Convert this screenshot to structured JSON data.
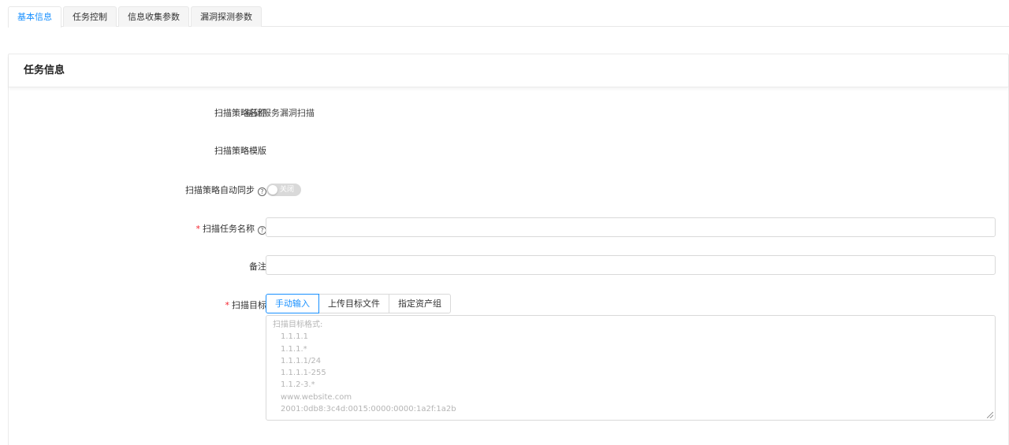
{
  "tabs": [
    {
      "label": "基本信息",
      "active": true
    },
    {
      "label": "任务控制",
      "active": false
    },
    {
      "label": "信息收集参数",
      "active": false
    },
    {
      "label": "漏洞探测参数",
      "active": false
    }
  ],
  "card": {
    "title": "任务信息",
    "fields": {
      "policy_name": {
        "label": "扫描策略名称",
        "value": "基础服务漏洞扫描"
      },
      "policy_template": {
        "label": "扫描策略模版",
        "value": "-"
      },
      "auto_sync": {
        "label": "扫描策略自动同步",
        "switch_text": "关闭",
        "on": false
      },
      "task_name": {
        "label": "扫描任务名称",
        "required": "*",
        "value": ""
      },
      "remark": {
        "label": "备注",
        "value": ""
      },
      "target": {
        "label": "扫描目标",
        "required": "*",
        "modes": [
          "手动输入",
          "上传目标文件",
          "指定资产组"
        ],
        "active_mode": "手动输入",
        "placeholder_title": "扫描目标格式:",
        "placeholder_lines": [
          "1.1.1.1",
          "1.1.1.*",
          "1.1.1.1/24",
          "1.1.1.1-255",
          "1.1.2-3.*",
          "www.website.com",
          "2001:0db8:3c4d:0015:0000:0000:1a2f:1a2b"
        ]
      }
    }
  },
  "help_icon_glyph": "?",
  "colors": {
    "accent": "#1890ff",
    "required": "#f5222d",
    "switch_off": "#d9d9d9"
  }
}
